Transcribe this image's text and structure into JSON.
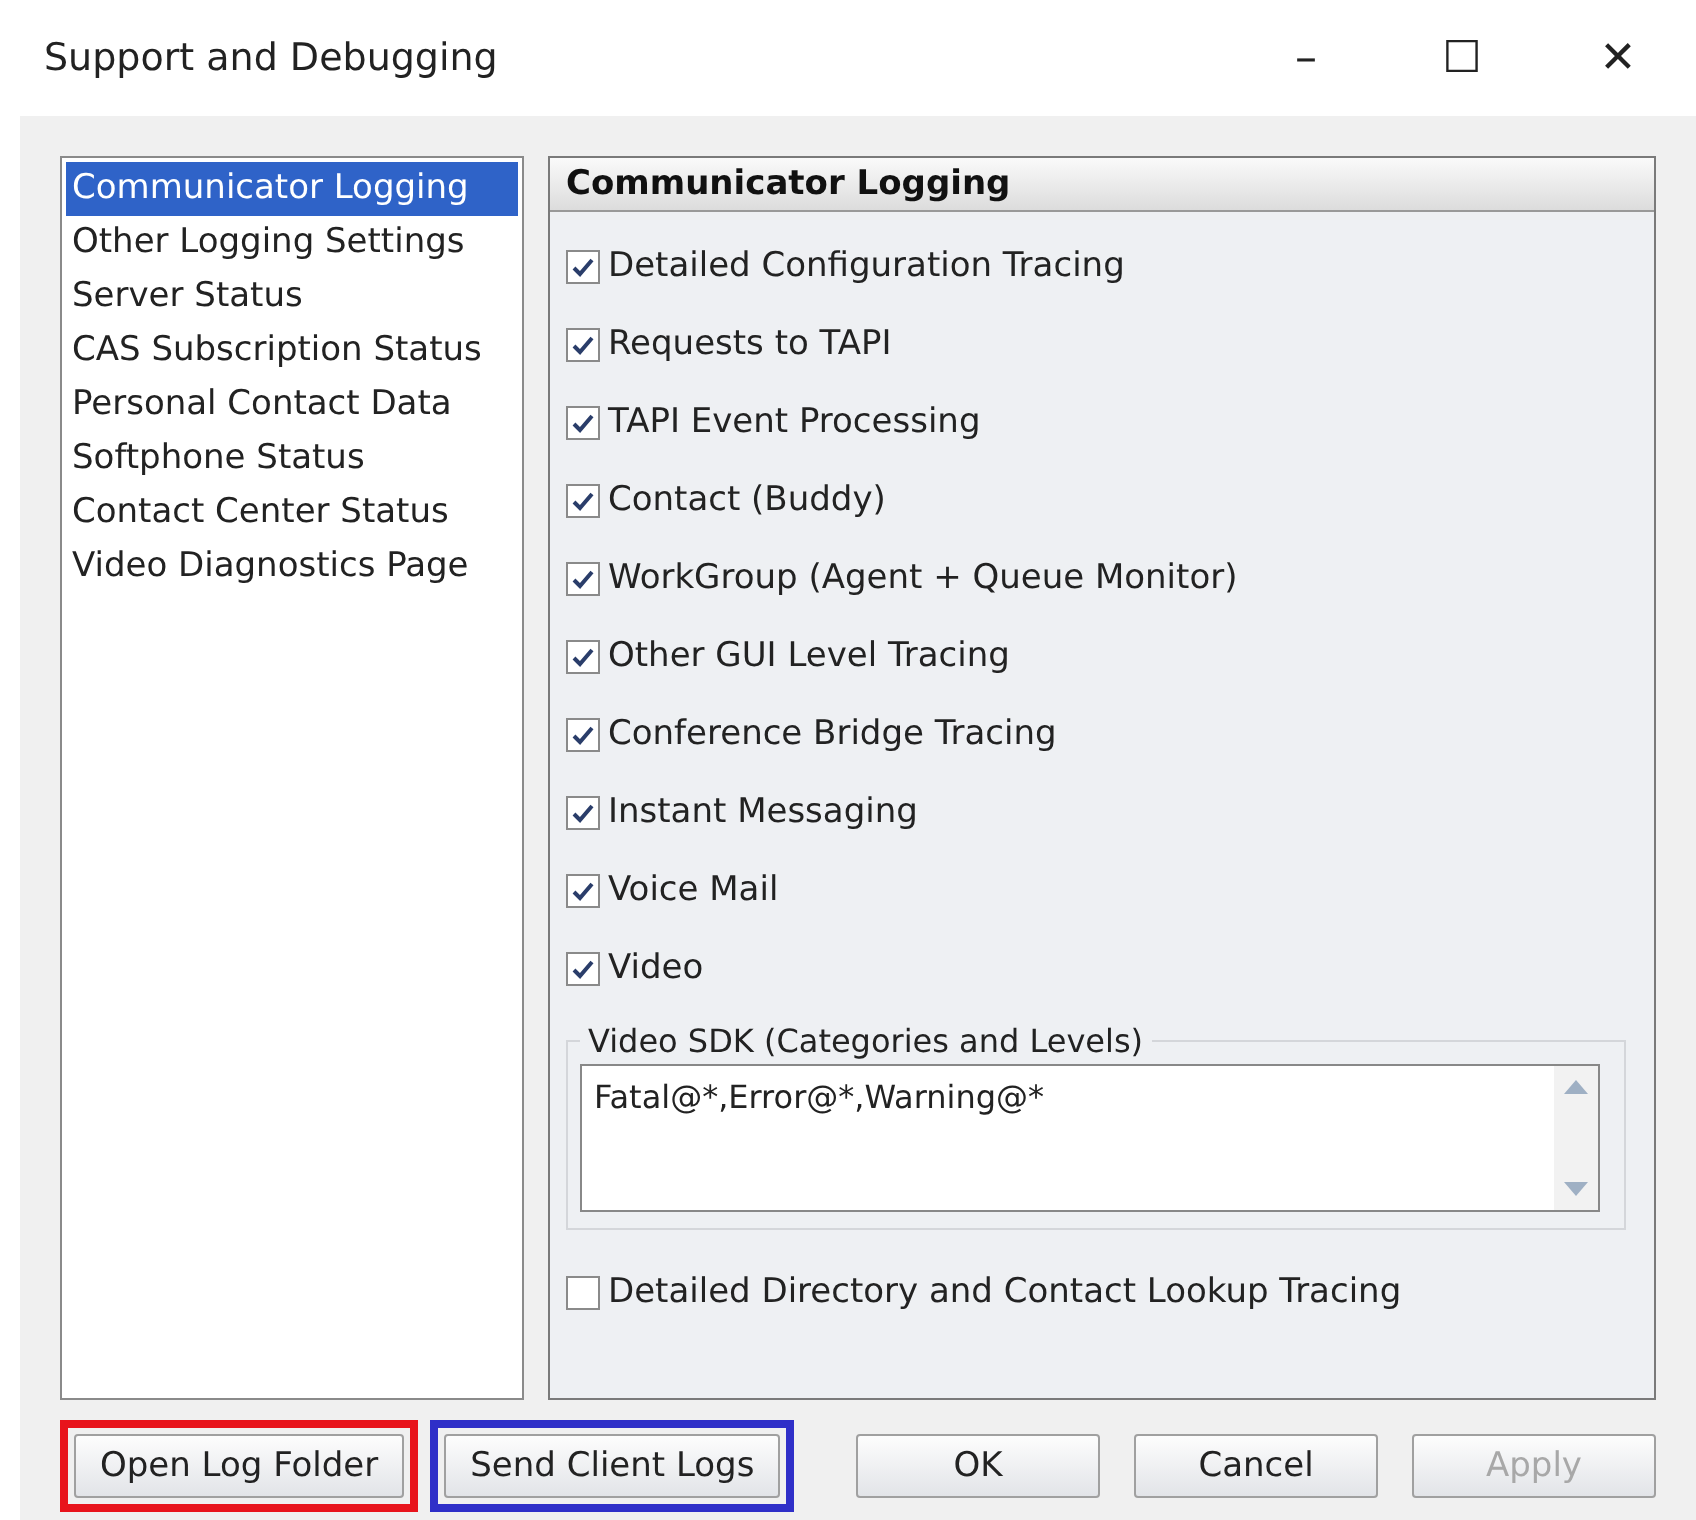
{
  "window": {
    "title": "Support and Debugging",
    "controls": [
      "–",
      "☐",
      "✕"
    ]
  },
  "sidebar": {
    "items": [
      {
        "label": "Communicator Logging",
        "selected": true
      },
      {
        "label": "Other Logging Settings",
        "selected": false
      },
      {
        "label": "Server Status",
        "selected": false
      },
      {
        "label": "CAS Subscription Status",
        "selected": false
      },
      {
        "label": "Personal Contact Data",
        "selected": false
      },
      {
        "label": "Softphone Status",
        "selected": false
      },
      {
        "label": "Contact Center Status",
        "selected": false
      },
      {
        "label": "Video Diagnostics Page",
        "selected": false
      }
    ]
  },
  "panel": {
    "title": "Communicator Logging",
    "options": [
      {
        "label": "Detailed Configuration Tracing",
        "checked": true
      },
      {
        "label": "Requests to TAPI",
        "checked": true
      },
      {
        "label": "TAPI Event Processing",
        "checked": true
      },
      {
        "label": "Contact (Buddy)",
        "checked": true
      },
      {
        "label": "WorkGroup (Agent + Queue Monitor)",
        "checked": true
      },
      {
        "label": "Other GUI Level Tracing",
        "checked": true
      },
      {
        "label": "Conference Bridge Tracing",
        "checked": true
      },
      {
        "label": "Instant Messaging",
        "checked": true
      },
      {
        "label": "Voice Mail",
        "checked": true
      },
      {
        "label": "Video",
        "checked": true
      }
    ],
    "group": {
      "title": "Video SDK (Categories and Levels)",
      "value": "Fatal@*,Error@*,Warning@*"
    },
    "bottom_option": {
      "label": "Detailed Directory and Contact Lookup Tracing",
      "checked": false
    }
  },
  "left_buttons": [
    {
      "label": "Open Log Folder",
      "color": "#e8141c"
    },
    {
      "label": "Send Client Logs",
      "color": "#2f2fc8"
    }
  ],
  "right_buttons": [
    {
      "label": "OK",
      "disabled": false
    },
    {
      "label": "Cancel",
      "disabled": false
    },
    {
      "label": "Apply",
      "disabled": true
    }
  ]
}
